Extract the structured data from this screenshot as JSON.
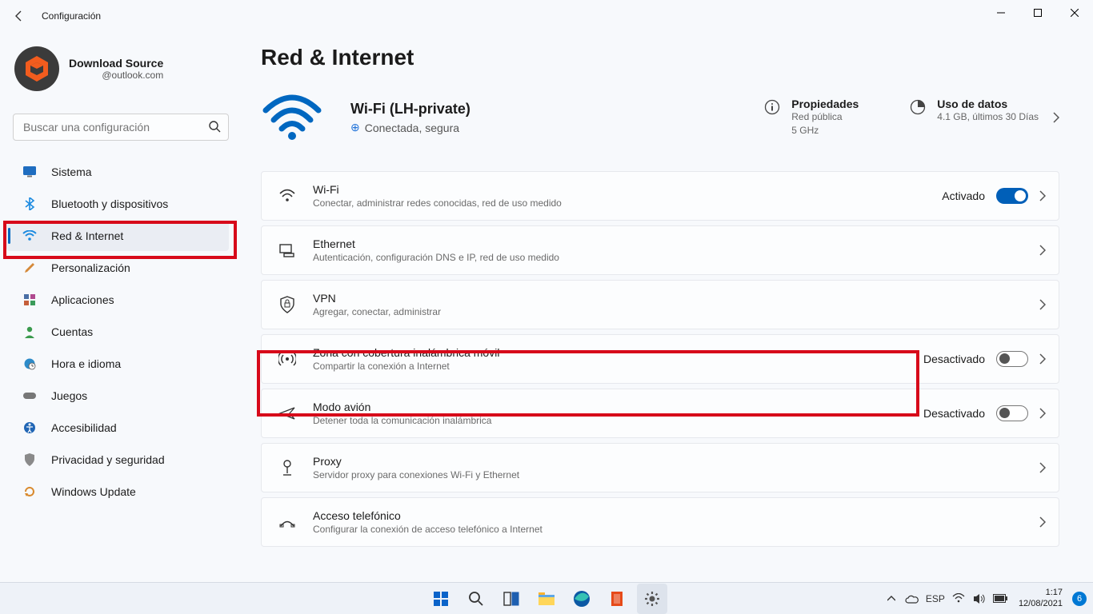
{
  "window": {
    "title": "Configuración"
  },
  "account": {
    "name": "Download Source",
    "email": "@outlook.com"
  },
  "search": {
    "placeholder": "Buscar una configuración"
  },
  "nav": {
    "system": "Sistema",
    "bluetooth": "Bluetooth y dispositivos",
    "network": "Red & Internet",
    "personalization": "Personalización",
    "apps": "Aplicaciones",
    "accounts": "Cuentas",
    "time": "Hora e idioma",
    "gaming": "Juegos",
    "accessibility": "Accesibilidad",
    "privacy": "Privacidad y seguridad",
    "update": "Windows Update"
  },
  "page": {
    "title": "Red & Internet"
  },
  "hero": {
    "ssid_label": "Wi-Fi (LH-private)",
    "status": "Conectada, segura",
    "props_title": "Propiedades",
    "props_line1": "Red pública",
    "props_line2": "5 GHz",
    "data_title": "Uso de datos",
    "data_sub": "4.1 GB, últimos 30 Días"
  },
  "cards": {
    "wifi": {
      "title": "Wi-Fi",
      "sub": "Conectar, administrar redes conocidas, red de uso medido",
      "state": "Activado"
    },
    "ethernet": {
      "title": "Ethernet",
      "sub": "Autenticación, configuración DNS e IP, red de uso medido"
    },
    "vpn": {
      "title": "VPN",
      "sub": "Agregar, conectar, administrar"
    },
    "hotspot": {
      "title": "Zona con cobertura inalámbrica móvil",
      "sub": "Compartir la conexión a Internet",
      "state": "Desactivado"
    },
    "airplane": {
      "title": "Modo avión",
      "sub": "Detener toda la comunicación inalámbrica",
      "state": "Desactivado"
    },
    "proxy": {
      "title": "Proxy",
      "sub": "Servidor proxy para conexiones Wi-Fi y Ethernet"
    },
    "dialup": {
      "title": "Acceso telefónico",
      "sub": "Configurar la conexión de acceso telefónico a Internet"
    }
  },
  "taskbar": {
    "lang": "ESP",
    "time": "1:17",
    "date": "12/08/2021",
    "badge": "6"
  }
}
